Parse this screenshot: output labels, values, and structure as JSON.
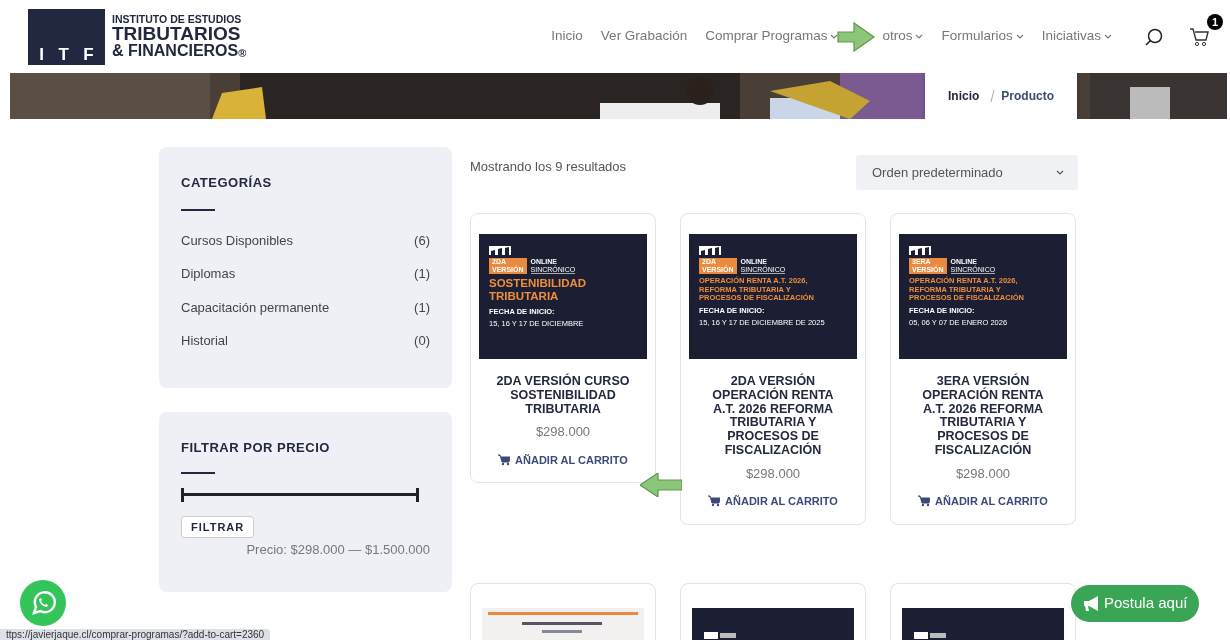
{
  "header": {
    "logo": {
      "mark": [
        "I",
        "T",
        "F"
      ],
      "line1": "INSTITUTO DE ESTUDIOS",
      "line2": "TRIBUTARIOS",
      "line3": "& FINANCIEROS",
      "registered": "®"
    },
    "nav": [
      {
        "label": "Inicio",
        "dropdown": false
      },
      {
        "label": "Ver Grabación",
        "dropdown": false
      },
      {
        "label": "Comprar Programas",
        "dropdown": true
      },
      {
        "label": "otros",
        "dropdown": true
      },
      {
        "label": "Formularios",
        "dropdown": true
      },
      {
        "label": "Iniciativas",
        "dropdown": true
      }
    ],
    "cart_count": "1"
  },
  "hero": {
    "kind": "picture",
    "breadcrumb": [
      "Inicio",
      "Producto"
    ]
  },
  "sidebar": {
    "categories": {
      "title": "CATEGORÍAS",
      "items": [
        {
          "name": "Cursos Disponibles",
          "count": "(6)"
        },
        {
          "name": "Diplomas",
          "count": "(1)"
        },
        {
          "name": "Capacitación permanente",
          "count": "(1)"
        },
        {
          "name": "Historial",
          "count": "(0)"
        }
      ]
    },
    "price_filter": {
      "title": "FILTRAR POR PRECIO",
      "slider": {
        "handles": [
          {
            "level": 0
          },
          {
            "level": 1
          }
        ]
      },
      "button": "FILTRAR",
      "range": "Precio: $298.000 — $1.500.000"
    }
  },
  "results": "Mostrando los 9 resultados",
  "sort": "Orden predeterminado",
  "products": [
    {
      "banner": {
        "edition": [
          "2DA",
          "VERSIÓN"
        ],
        "mode": [
          "ONLINE",
          "SINCRÓNICO"
        ],
        "headline": [
          "SOSTENIBILIDAD",
          "TRIBUTARIA"
        ],
        "big": true,
        "date_label": "FECHA DE INICIO:",
        "dates": "15, 16 Y 17 DE DICIEMBRE"
      },
      "title": "2DA VERSIÓN CURSO SOSTENIBILIDAD TRIBUTARIA",
      "price": "$298.000",
      "action": "AÑADIR AL CARRITO"
    },
    {
      "banner": {
        "edition": [
          "2DA",
          "VERSIÓN"
        ],
        "mode": [
          "ONLINE",
          "SINCRÓNICO"
        ],
        "headline": [
          "OPERACIÓN RENTA A.T. 2026,",
          "REFORMA TRIBUTARIA Y",
          "PROCESOS DE FISCALIZACIÓN"
        ],
        "big": false,
        "date_label": "FECHA DE INICIO:",
        "dates": "15, 16 Y 17 DE DICIEMBRE DE 2025"
      },
      "title": "2DA VERSIÓN OPERACIÓN RENTA A.T. 2026 REFORMA TRIBUTARIA Y PROCESOS DE FISCALIZACIÓN",
      "price": "$298.000",
      "action": "AÑADIR AL CARRITO"
    },
    {
      "banner": {
        "edition": [
          "3ERA",
          "VERSIÓN"
        ],
        "mode": [
          "ONLINE",
          "SINCRÓNICO"
        ],
        "headline": [
          "OPERACIÓN RENTA A.T. 2026,",
          "REFORMA TRIBUTARIA Y",
          "PROCESOS DE FISCALIZACIÓN"
        ],
        "big": false,
        "date_label": "FECHA DE INICIO:",
        "dates": "05, 06 Y 07 DE ENERO 2026"
      },
      "title": "3ERA VERSIÓN OPERACIÓN RENTA A.T. 2026 REFORMA TRIBUTARIA Y PROCESOS DE FISCALIZACIÓN",
      "price": "$298.000",
      "action": "AÑADIR AL CARRITO"
    }
  ],
  "more_products": [
    {
      "kind": "light"
    },
    {
      "kind": "dark"
    },
    {
      "kind": "dark"
    }
  ],
  "postula": "Postula aquí",
  "status_url": "ttps://javierjaque.cl/comprar-programas/?add-to-cart=2360"
}
